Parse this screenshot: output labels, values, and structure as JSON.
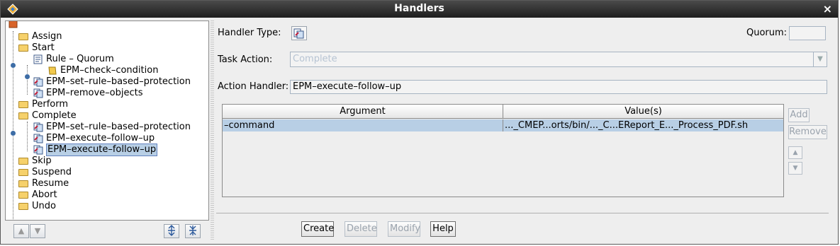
{
  "window": {
    "title": "Handlers"
  },
  "tree": {
    "items": [
      {
        "label": "Assign",
        "kind": "folder"
      },
      {
        "label": "Start",
        "kind": "folder"
      },
      {
        "label": "Rule – Quorum",
        "kind": "rule"
      },
      {
        "label": "EPM–check–condition",
        "kind": "condition"
      },
      {
        "label": "EPM–set–rule–based–protection",
        "kind": "handler"
      },
      {
        "label": "EPM–remove–objects",
        "kind": "handler"
      },
      {
        "label": "Perform",
        "kind": "folder"
      },
      {
        "label": "Complete",
        "kind": "folder"
      },
      {
        "label": "EPM–set–rule–based–protection",
        "kind": "handler"
      },
      {
        "label": "EPM–execute–follow–up",
        "kind": "handler"
      },
      {
        "label": "EPM–execute–follow–up",
        "kind": "handler",
        "selected": true
      },
      {
        "label": "Skip",
        "kind": "folder"
      },
      {
        "label": "Suspend",
        "kind": "folder"
      },
      {
        "label": "Resume",
        "kind": "folder"
      },
      {
        "label": "Abort",
        "kind": "folder"
      },
      {
        "label": "Undo",
        "kind": "folder"
      }
    ]
  },
  "form": {
    "handler_type_label": "Handler Type:",
    "quorum_label": "Quorum:",
    "quorum_value": "",
    "task_action_label": "Task Action:",
    "task_action_value": "Complete",
    "action_handler_label": "Action Handler:",
    "action_handler_value": "EPM–execute–follow–up"
  },
  "table": {
    "headers": [
      "Argument",
      "Value(s)"
    ],
    "rows": [
      {
        "argument": "–command",
        "value": "..._CMEP...orts/bin/..._C...EReport_E..._Process_PDF.sh"
      }
    ]
  },
  "side_buttons": {
    "add": "Add",
    "remove": "Remove"
  },
  "buttons": {
    "create": "Create",
    "delete": "Delete",
    "modify": "Modify",
    "help": "Help"
  },
  "colors": {
    "selection": "#b8cfe5",
    "titlebar": "#2a2a2a",
    "folder": "#f6d16b"
  }
}
